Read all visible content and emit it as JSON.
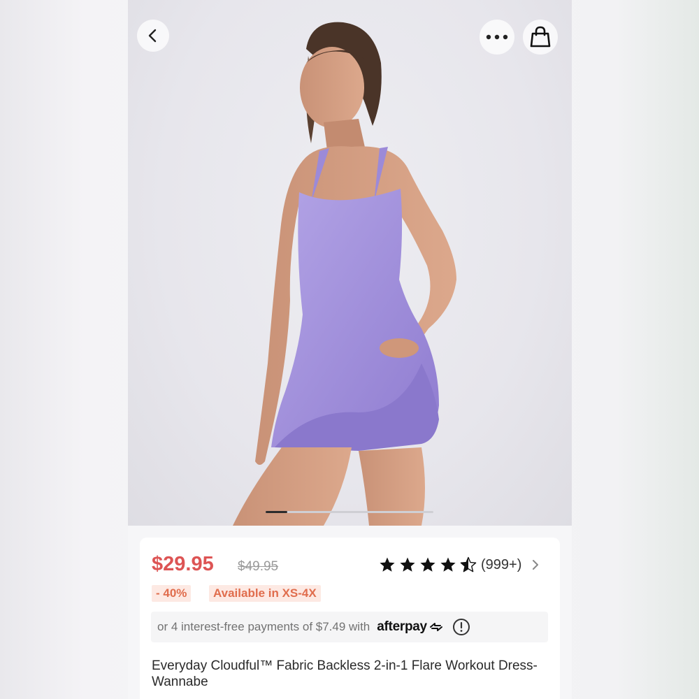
{
  "product": {
    "price": "$29.95",
    "original_price": "$49.95",
    "discount_badge": "- 40%",
    "availability_badge": "Available in XS-4X",
    "rating": 4.5,
    "rating_max": 5,
    "rating_count": "(999+)",
    "afterpay_text": "or 4 interest-free payments of $7.49 with",
    "afterpay_brand": "afterpay",
    "title": "Everyday Cloudful™ Fabric Backless 2-in-1 Flare Workout Dress-Wannabe"
  },
  "gallery": {
    "current_index": 1,
    "progress": 0.13
  },
  "icons": {
    "back": "chevron-left-icon",
    "more": "more-horizontal-icon",
    "cart": "shopping-bag-icon",
    "rating_more": "chevron-right-icon",
    "info": "exclamation-circle-icon"
  },
  "colors": {
    "price": "#dd5454",
    "badge_text": "#e06d4d",
    "badge_bg": "#fde9e3",
    "dress": "#a08fd8"
  }
}
